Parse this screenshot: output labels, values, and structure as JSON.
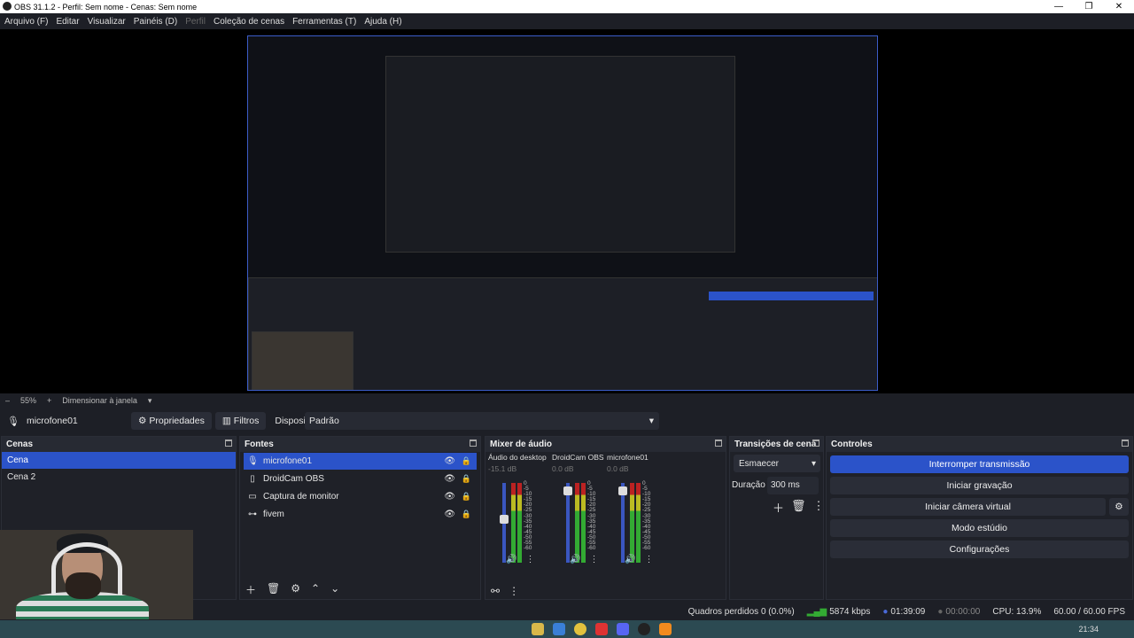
{
  "window": {
    "title": "OBS 31.1.2 - Perfil: Sem nome - Cenas: Sem nome"
  },
  "menu": [
    "Arquivo (F)",
    "Editar",
    "Visualizar",
    "Painéis (D)",
    "Perfil",
    "Coleção de cenas",
    "Ferramentas (T)",
    "Ajuda (H)"
  ],
  "zoom": {
    "minus": "–",
    "value": "55%",
    "plus": "+",
    "mode": "Dimensionar à janela"
  },
  "propbar": {
    "source": "microfone01",
    "props": "Propriedades",
    "filters": "Filtros",
    "device_label": "Dispositivo",
    "device_value": "Padrão"
  },
  "scenes": {
    "title": "Cenas",
    "items": [
      "Cena",
      "Cena 2"
    ]
  },
  "sources": {
    "title": "Fontes",
    "items": [
      "microfone01",
      "DroidCam OBS",
      "Captura de monitor",
      "fivem"
    ]
  },
  "mixer": {
    "title": "Mixer de áudio",
    "channels": [
      {
        "name": "Áudio do desktop",
        "db": "-15.1 dB",
        "level": 0.55
      },
      {
        "name": "DroidCam OBS",
        "db": "0.0 dB",
        "level": 0.95
      },
      {
        "name": "microfone01",
        "db": "0.0 dB",
        "level": 0.95
      }
    ],
    "scale": [
      "0",
      "-5",
      "-10",
      "-15",
      "-20",
      "-25",
      "-30",
      "-35",
      "-40",
      "-45",
      "-50",
      "-55",
      "-60"
    ]
  },
  "transitions": {
    "title": "Transições de cena",
    "type": "Esmaecer",
    "duration_label": "Duração",
    "duration": "300 ms"
  },
  "controls": {
    "title": "Controles",
    "buttons": [
      "Interromper transmissão",
      "Iniciar gravação",
      "Iniciar câmera virtual",
      "Modo estúdio",
      "Configurações"
    ]
  },
  "status": {
    "frames": "Quadros perdidos 0 (0.0%)",
    "bitrate": "5874 kbps",
    "live": "01:39:09",
    "rec": "00:00:00",
    "cpu": "CPU: 13.9%",
    "fps": "60.00 / 60.00 FPS"
  },
  "taskbar": {
    "time": "21:34"
  },
  "colors": {
    "accent": "#2b53c9",
    "bg": "#1d1f26",
    "panel": "#1f2128"
  }
}
